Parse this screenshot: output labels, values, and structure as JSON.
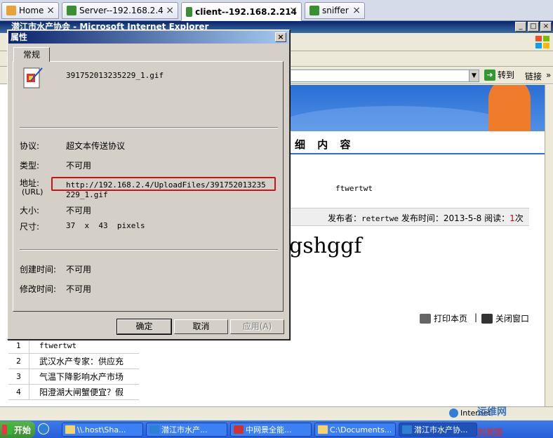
{
  "host_tabs": [
    {
      "label": "Home",
      "active": false,
      "icon": "home-icon"
    },
    {
      "label": "Server--192.168.2.4",
      "active": false,
      "icon": "vm-icon"
    },
    {
      "label": "client--192.168.2.214",
      "active": true,
      "icon": "vm-icon"
    },
    {
      "label": "sniffer",
      "active": false,
      "icon": "vm-icon"
    }
  ],
  "ie": {
    "title": "潜江市水产协会 - Microsoft Internet Explorer",
    "go_label": "转到",
    "links_label": "链接",
    "links_ext": "»"
  },
  "page": {
    "section_title": "细 内 容",
    "article_title": "ftwertwt",
    "info": {
      "prefix": "发布者：",
      "publisher": "retertwe",
      "time_label": " 发布时间：",
      "time": "2013-5-8",
      "reads_label": " 阅读：",
      "reads": "1",
      "reads_unit": "次"
    },
    "body_text": "gshggf",
    "print_label": "打印本页",
    "separator": "|",
    "close_label": "关闭窗口"
  },
  "rank_list": [
    {
      "num": "1",
      "text": "ftwertwt"
    },
    {
      "num": "2",
      "text": "武汉水产专家：供应充"
    },
    {
      "num": "3",
      "text": "气温下降影响水产市场"
    },
    {
      "num": "4",
      "text": "阳澄湖大闸蟹便宜？假"
    }
  ],
  "status": {
    "zone": "Internet"
  },
  "taskbar": {
    "start": "开始",
    "tasks": [
      {
        "label": "\\\\.host\\Sha...",
        "active": false
      },
      {
        "label": "潜江市水产...",
        "active": false
      },
      {
        "label": "中网景全能...",
        "active": false
      },
      {
        "label": "C:\\Documents...",
        "active": false
      },
      {
        "label": "潜江市水产协...",
        "active": true
      }
    ]
  },
  "watermark": {
    "line1": "运维网",
    "line2": "刘发国"
  },
  "dialog": {
    "title": "属性",
    "tab": "常规",
    "file_name": "391752013235229_1.gif",
    "rows": {
      "protocol_label": "协议:",
      "protocol_value": "超文本传送协议",
      "type_label": "类型:",
      "type_value": "不可用",
      "address_label": "地址:",
      "address_label2": "(URL)",
      "address_value": "http://192.168.2.4/UploadFiles/391752013235229_1.gif",
      "size_label": "大小:",
      "size_value": "不可用",
      "dims_label": "尺寸:",
      "dims_value": "37  x  43  pixels",
      "created_label": "创建时间:",
      "created_value": "不可用",
      "modified_label": "修改时间:",
      "modified_value": "不可用"
    },
    "buttons": {
      "ok": "确定",
      "cancel": "取消",
      "apply": "应用(A)"
    },
    "close": "×"
  }
}
